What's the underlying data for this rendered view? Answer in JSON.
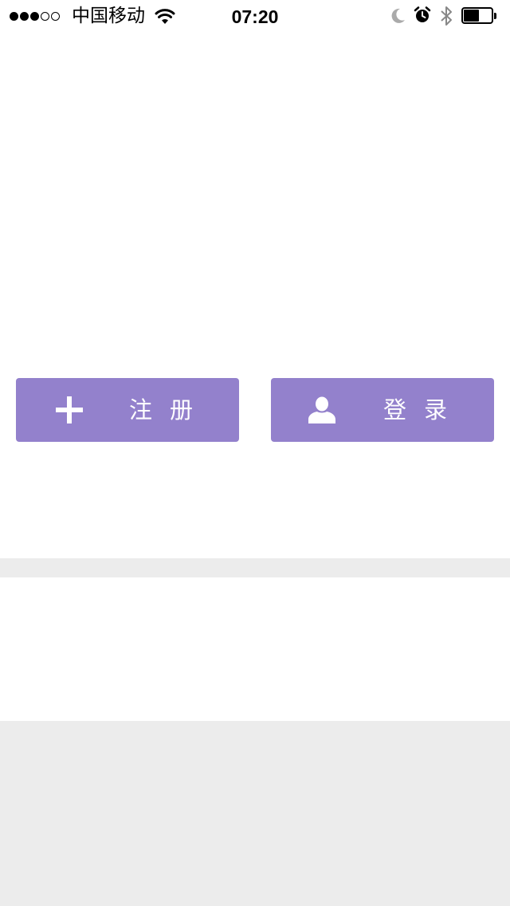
{
  "status_bar": {
    "signal_bars_filled": 3,
    "signal_bars_total": 5,
    "carrier": "中国移动",
    "time": "07:20",
    "icons": [
      "wifi-icon",
      "moon-icon",
      "alarm-icon",
      "bluetooth-icon",
      "battery-icon"
    ],
    "battery_level": 0.55
  },
  "actions": {
    "register": {
      "label": "注册",
      "icon": "plus-icon"
    },
    "login": {
      "label": "登录",
      "icon": "user-icon"
    }
  },
  "colors": {
    "button_bg": "#9381cc",
    "button_text": "#ffffff",
    "page_bg": "#ececec",
    "panel_bg": "#ffffff"
  }
}
